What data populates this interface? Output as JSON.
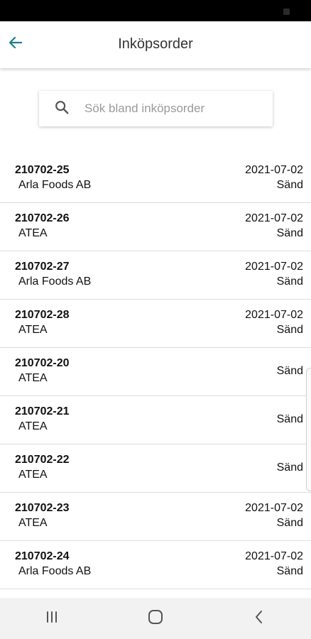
{
  "header": {
    "title": "Inköpsorder"
  },
  "search": {
    "placeholder": "Sök bland inköpsorder",
    "value": ""
  },
  "colors": {
    "accent": "#1a7f8e",
    "status_bar": "#000000",
    "nav_bar": "#f2f2f2"
  },
  "icons": {
    "back": "arrow-left-icon",
    "search": "search-icon",
    "nav_recents": "recents-icon",
    "nav_home": "home-icon",
    "nav_back": "chevron-left-icon"
  },
  "orders": [
    {
      "number": "210702-25",
      "supplier": "Arla Foods AB",
      "date": "2021-07-02",
      "status": "Sänd"
    },
    {
      "number": "210702-26",
      "supplier": "ATEA",
      "date": "2021-07-02",
      "status": "Sänd"
    },
    {
      "number": "210702-27",
      "supplier": "Arla Foods AB",
      "date": "2021-07-02",
      "status": "Sänd"
    },
    {
      "number": "210702-28",
      "supplier": "ATEA",
      "date": "2021-07-02",
      "status": "Sänd"
    },
    {
      "number": "210702-20",
      "supplier": "ATEA",
      "date": "",
      "status": "Sänd"
    },
    {
      "number": "210702-21",
      "supplier": "ATEA",
      "date": "",
      "status": "Sänd"
    },
    {
      "number": "210702-22",
      "supplier": "ATEA",
      "date": "",
      "status": "Sänd"
    },
    {
      "number": "210702-23",
      "supplier": "ATEA",
      "date": "2021-07-02",
      "status": "Sänd"
    },
    {
      "number": "210702-24",
      "supplier": "Arla Foods AB",
      "date": "2021-07-02",
      "status": "Sänd"
    }
  ]
}
